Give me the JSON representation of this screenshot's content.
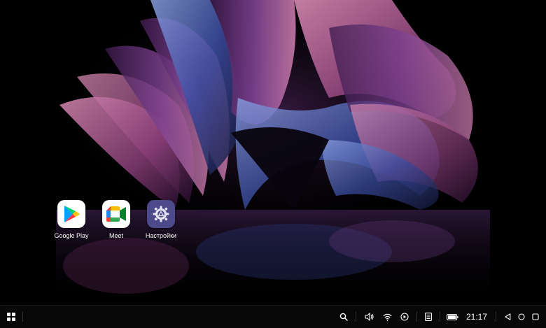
{
  "desktop": {
    "apps": [
      {
        "label": "Google Play",
        "icon": "google-play-icon"
      },
      {
        "label": "Meet",
        "icon": "google-meet-icon"
      },
      {
        "label": "Настройки",
        "icon": "settings-gear-icon"
      }
    ],
    "wallpaper": "abstract-purple-ribbons"
  },
  "taskbar": {
    "left": [
      {
        "icon": "app-launcher-icon"
      }
    ],
    "tray": [
      {
        "icon": "search-icon"
      },
      {
        "icon": "volume-icon"
      },
      {
        "icon": "wifi-icon"
      },
      {
        "icon": "record-icon"
      },
      {
        "icon": "notes-icon"
      },
      {
        "icon": "battery-icon"
      }
    ],
    "time": "21:17",
    "nav": [
      {
        "icon": "back-icon"
      },
      {
        "icon": "home-icon"
      },
      {
        "icon": "recents-icon"
      }
    ]
  },
  "colors": {
    "wallpaper_bg": "#000000",
    "ribbon_pink": "#c0709a",
    "ribbon_purple": "#6a3a86",
    "ribbon_blue": "#3a4a9a",
    "taskbar_bg": "#080808",
    "settings_tile": "#4d4a8c"
  }
}
